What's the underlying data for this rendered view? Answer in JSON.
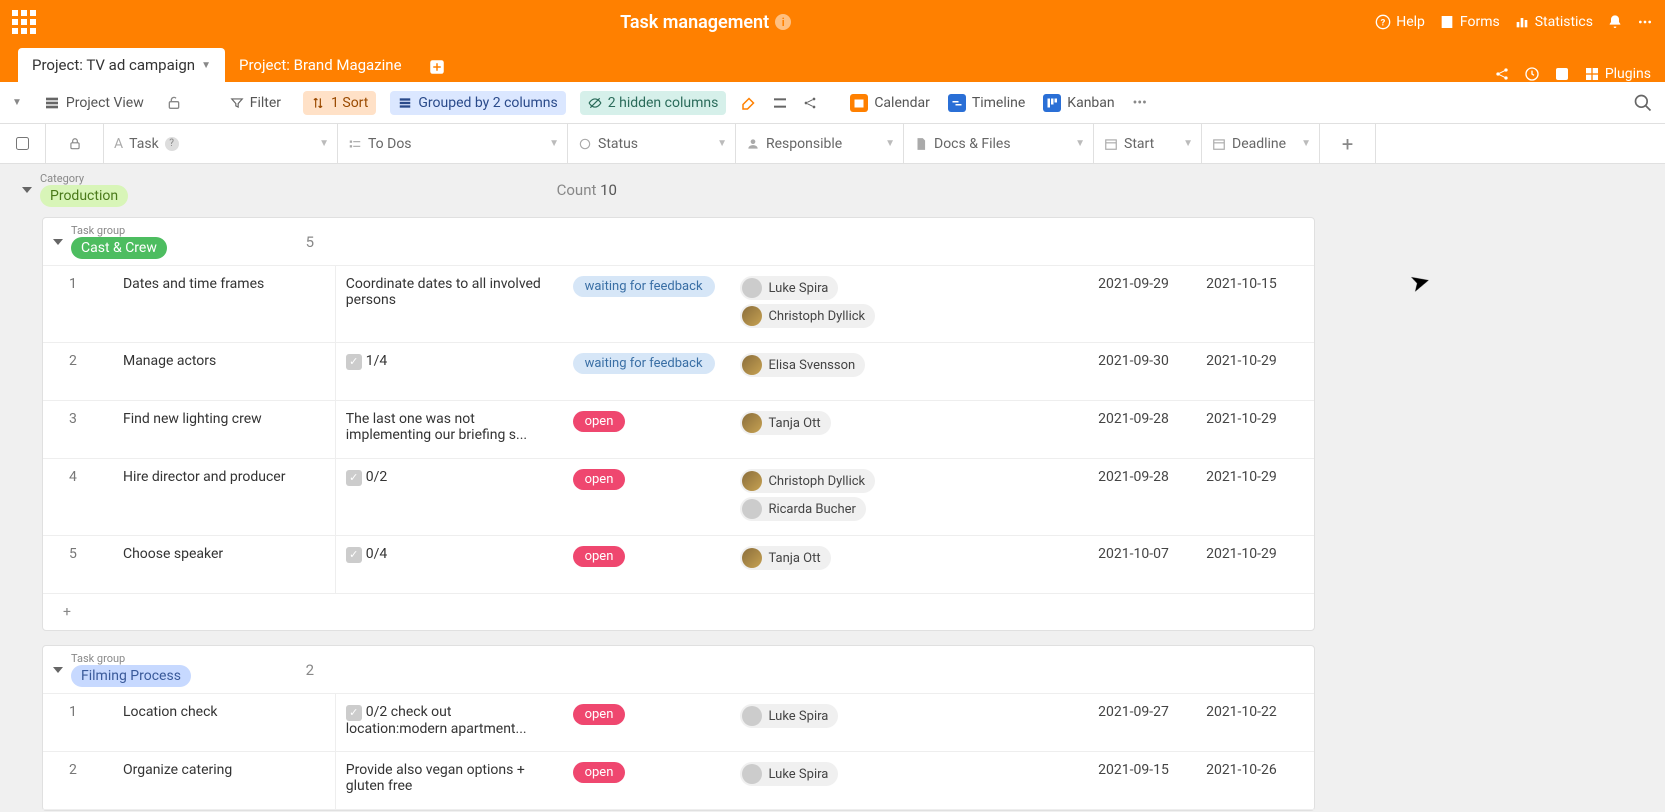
{
  "header": {
    "title": "Task management",
    "help": "Help",
    "forms": "Forms",
    "stats": "Statistics"
  },
  "tabs": {
    "active": "Project: TV ad campaign",
    "other": "Project: Brand Magazine",
    "plugins": "Plugins"
  },
  "toolbar": {
    "project_view": "Project View",
    "filter": "Filter",
    "sort": "1 Sort",
    "grouped": "Grouped by 2 columns",
    "hidden": "2 hidden columns",
    "calendar": "Calendar",
    "timeline": "Timeline",
    "kanban": "Kanban"
  },
  "columns": {
    "task": "Task",
    "todos": "To Dos",
    "status": "Status",
    "responsible": "Responsible",
    "docs": "Docs & Files",
    "start": "Start",
    "deadline": "Deadline"
  },
  "group_labels": {
    "category": "Category",
    "count": "Count",
    "taskgroup": "Task group"
  },
  "category": {
    "name": "Production",
    "count": "10"
  },
  "sg1": {
    "name": "Cast & Crew",
    "count": "5",
    "rows": [
      {
        "n": "1",
        "task": "Dates and time frames",
        "todo": "Coordinate dates to all involved persons",
        "status": "waiting for feedback",
        "stclass": "st-wait",
        "resp": [
          {
            "name": "Luke Spira",
            "img": false
          },
          {
            "name": "Christoph Dyllick",
            "img": true
          }
        ],
        "start": "2021-09-29",
        "dead": "2021-10-15",
        "check": ""
      },
      {
        "n": "2",
        "task": "Manage actors",
        "todo": "",
        "check": "1/4",
        "status": "waiting for feedback",
        "stclass": "st-wait",
        "resp": [
          {
            "name": "Elisa Svensson",
            "img": true
          }
        ],
        "start": "2021-09-30",
        "dead": "2021-10-29"
      },
      {
        "n": "3",
        "task": "Find new lighting crew",
        "todo": "The last one was not implementing our briefing s...",
        "check": "",
        "status": "open",
        "stclass": "st-open",
        "resp": [
          {
            "name": "Tanja Ott",
            "img": true
          }
        ],
        "start": "2021-09-28",
        "dead": "2021-10-29"
      },
      {
        "n": "4",
        "task": "Hire director and producer",
        "todo": "",
        "check": "0/2",
        "status": "open",
        "stclass": "st-open",
        "resp": [
          {
            "name": "Christoph Dyllick",
            "img": true
          },
          {
            "name": "Ricarda Bucher",
            "img": false
          }
        ],
        "start": "2021-09-28",
        "dead": "2021-10-29"
      },
      {
        "n": "5",
        "task": "Choose speaker",
        "todo": "",
        "check": "0/4",
        "status": "open",
        "stclass": "st-open",
        "resp": [
          {
            "name": "Tanja Ott",
            "img": true
          }
        ],
        "start": "2021-10-07",
        "dead": "2021-10-29"
      }
    ]
  },
  "sg2": {
    "name": "Filming Process",
    "count": "2",
    "rows": [
      {
        "n": "1",
        "task": "Location check",
        "todo": "check out location:modern apartment...",
        "check": "0/2",
        "status": "open",
        "stclass": "st-open",
        "resp": [
          {
            "name": "Luke Spira",
            "img": false
          }
        ],
        "start": "2021-09-27",
        "dead": "2021-10-22"
      },
      {
        "n": "2",
        "task": "Organize catering",
        "todo": "Provide also vegan options + gluten free",
        "check": "",
        "status": "open",
        "stclass": "st-open",
        "resp": [
          {
            "name": "Luke Spira",
            "img": false
          }
        ],
        "start": "2021-09-15",
        "dead": "2021-10-26"
      }
    ]
  }
}
